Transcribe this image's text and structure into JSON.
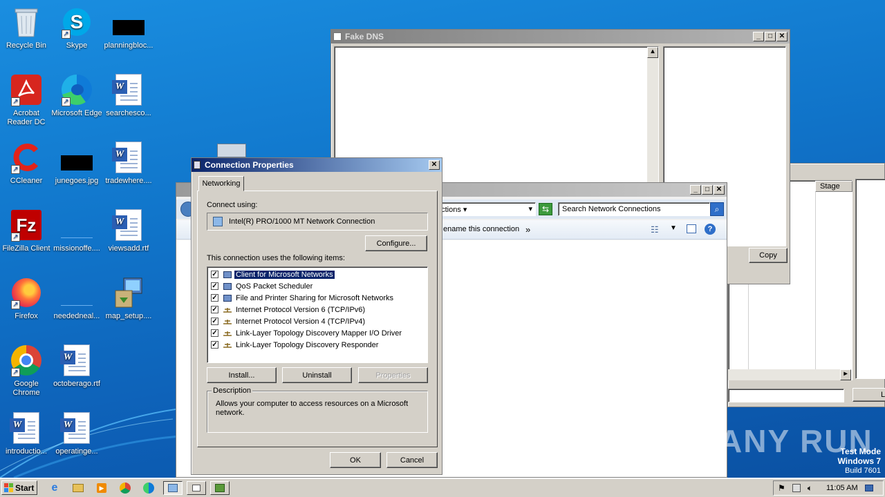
{
  "desktop": {
    "icons": [
      {
        "label": "Recycle Bin"
      },
      {
        "label": "Skype"
      },
      {
        "label": "planningbloc..."
      },
      {
        "label": "Acrobat Reader DC"
      },
      {
        "label": "Microsoft Edge"
      },
      {
        "label": "searchesco..."
      },
      {
        "label": "CCleaner"
      },
      {
        "label": "junegoes.jpg"
      },
      {
        "label": "tradewhere...."
      },
      {
        "label": "FileZilla Client"
      },
      {
        "label": "missionoffe...."
      },
      {
        "label": "viewsadd.rtf"
      },
      {
        "label": "Firefox"
      },
      {
        "label": "neededneal..."
      },
      {
        "label": "map_setup...."
      },
      {
        "label": "Google Chrome"
      },
      {
        "label": "octoberago.rtf"
      },
      {
        "label": "introductio..."
      },
      {
        "label": "operatinge..."
      }
    ]
  },
  "fake_dns": {
    "title": "Fake DNS",
    "copy_button": "Copy"
  },
  "network_connections": {
    "address": "ections",
    "search_placeholder": "Search Network Connections",
    "command": "ename this connection",
    "overflow": "»"
  },
  "right_window": {
    "column_stage": "Stage",
    "button_partial": "Li"
  },
  "connection_properties": {
    "title": "Connection Properties",
    "tab": "Networking",
    "connect_using_label": "Connect using:",
    "adapter": "Intel(R) PRO/1000 MT Network Connection",
    "configure_button": "Configure...",
    "items_label": "This connection uses the following items:",
    "items": [
      {
        "label": "Client for Microsoft Networks",
        "checked": true,
        "selected": true
      },
      {
        "label": "QoS Packet Scheduler",
        "checked": true,
        "selected": false
      },
      {
        "label": "File and Printer Sharing for Microsoft Networks",
        "checked": true,
        "selected": false
      },
      {
        "label": "Internet Protocol Version 6 (TCP/IPv6)",
        "checked": true,
        "selected": false
      },
      {
        "label": "Internet Protocol Version 4 (TCP/IPv4)",
        "checked": true,
        "selected": false
      },
      {
        "label": "Link-Layer Topology Discovery Mapper I/O Driver",
        "checked": true,
        "selected": false
      },
      {
        "label": "Link-Layer Topology Discovery Responder",
        "checked": true,
        "selected": false
      }
    ],
    "install_button": "Install...",
    "uninstall_button": "Uninstall",
    "properties_button": "Properties",
    "description_group": "Description",
    "description_text": "Allows your computer to access resources on a Microsoft network.",
    "ok_button": "OK",
    "cancel_button": "Cancel"
  },
  "watermark": {
    "brand": "ANY RUN",
    "test_mode": "Test Mode",
    "os": "Windows 7",
    "build": "Build 7601"
  },
  "taskbar": {
    "start_label": "Start",
    "clock": "11:05 AM"
  }
}
